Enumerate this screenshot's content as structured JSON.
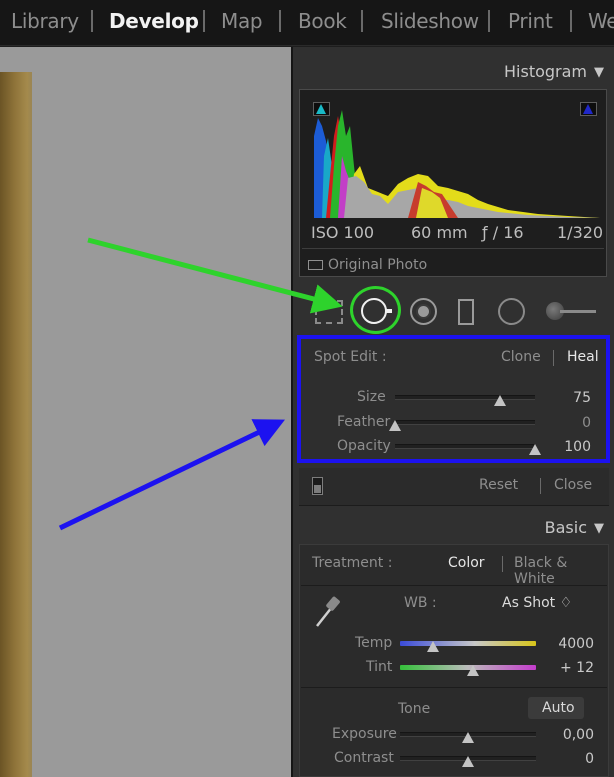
{
  "modules": [
    "Library",
    "Develop",
    "Map",
    "Book",
    "Slideshow",
    "Print",
    "We"
  ],
  "active_module": "Develop",
  "histogram": {
    "title": "Histogram",
    "iso": "ISO 100",
    "focal": "60 mm",
    "aperture": "ƒ / 16",
    "shutter": "1/320",
    "original_label": "Original Photo"
  },
  "tools": [
    "crop-overlay",
    "spot-removal",
    "red-eye-correction",
    "graduated-filter",
    "radial-filter",
    "adjustment-brush"
  ],
  "spot_edit": {
    "label": "Spot Edit :",
    "mode_clone": "Clone",
    "mode_heal": "Heal",
    "active_mode": "Heal",
    "sliders": [
      {
        "label": "Size",
        "value": "75",
        "fraction": 0.75
      },
      {
        "label": "Feather",
        "value": "0",
        "fraction": 0.0
      },
      {
        "label": "Opacity",
        "value": "100",
        "fraction": 1.0
      }
    ],
    "reset": "Reset",
    "close": "Close"
  },
  "basic": {
    "title": "Basic",
    "treatment_label": "Treatment :",
    "treatment_color": "Color",
    "treatment_bw": "Black & White",
    "wb_label": "WB :",
    "wb_value": "As Shot ♢",
    "temp": {
      "label": "Temp",
      "value": "4000",
      "fraction": 0.24
    },
    "tint": {
      "label": "Tint",
      "value": "+ 12",
      "fraction": 0.54
    },
    "tone_label": "Tone",
    "auto": "Auto",
    "exposure": {
      "label": "Exposure",
      "value": "0,00",
      "fraction": 0.5
    },
    "contrast": {
      "label": "Contrast",
      "value": "0",
      "fraction": 0.5
    }
  },
  "colors": {
    "annotation_green": "#2ed32c",
    "annotation_blue": "#1c12f0"
  }
}
